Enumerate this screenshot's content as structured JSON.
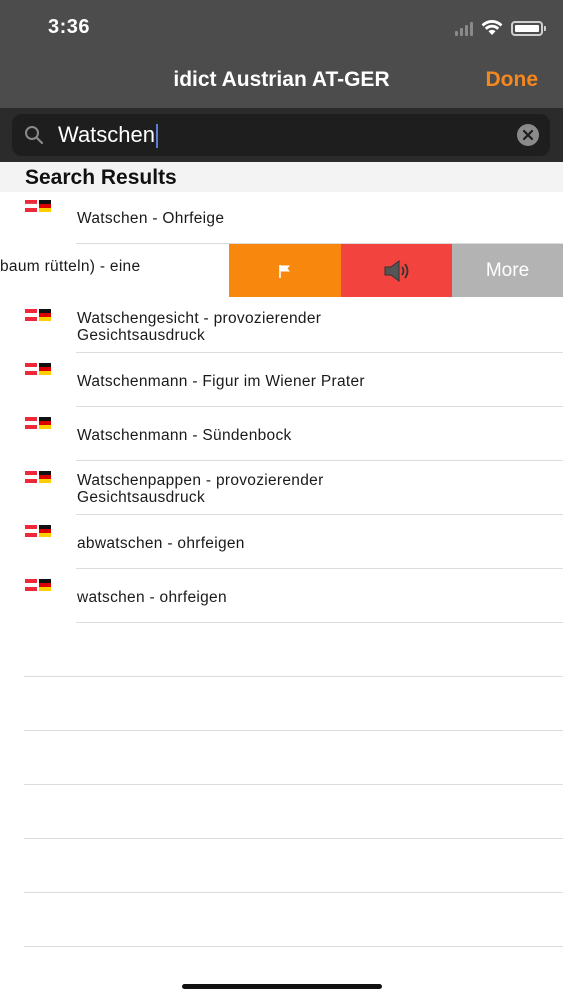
{
  "status_bar": {
    "time": "3:36"
  },
  "nav": {
    "title": "idict Austrian AT-GER",
    "done_label": "Done"
  },
  "search": {
    "query": "Watschen"
  },
  "results_header": "Search Results",
  "swipe_row": {
    "text": "baum rütteln) - eine",
    "more_label": "More"
  },
  "results": [
    {
      "line1": "Watschen - Ohrfeige",
      "line2": ""
    },
    {
      "line1": "Watschengesicht - provozierender",
      "line2": "Gesichtsausdruck"
    },
    {
      "line1": "Watschenmann - Figur im Wiener Prater",
      "line2": ""
    },
    {
      "line1": "Watschenmann - Sündenbock",
      "line2": ""
    },
    {
      "line1": "Watschenpappen - provozierender",
      "line2": "Gesichtsausdruck"
    },
    {
      "line1": "abwatschen - ohrfeigen",
      "line2": ""
    },
    {
      "line1": "watschen - ohrfeigen",
      "line2": ""
    }
  ],
  "colors": {
    "accent": "#f5871f",
    "flag_action": "#f7880d",
    "sound_action": "#f2433f",
    "more_action": "#b3b3b3"
  }
}
